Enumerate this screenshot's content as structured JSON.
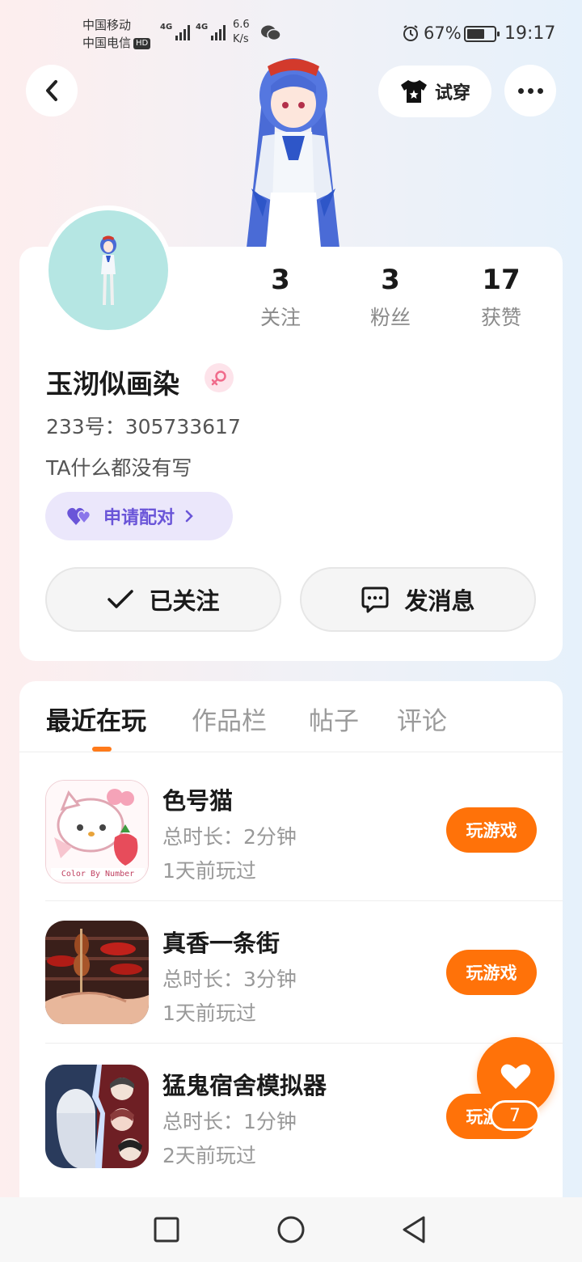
{
  "status_bar": {
    "carrier_1": "中国移动",
    "carrier_2": "中国电信",
    "hd_badge": "HD",
    "network_1": "4G",
    "network_2": "4G",
    "net_speed_value": "6.6",
    "net_speed_unit": "K/s",
    "battery_percent": "67%",
    "battery_level": 0.67,
    "time": "19:17"
  },
  "header": {
    "try_on_label": "试穿"
  },
  "profile": {
    "stats": [
      {
        "value": "3",
        "label": "关注"
      },
      {
        "value": "3",
        "label": "粉丝"
      },
      {
        "value": "17",
        "label": "获赞"
      }
    ],
    "nickname": "玉沏似画染",
    "uid": "233号：305733617",
    "bio": "TA什么都没有写",
    "pair_label": "申请配对",
    "follow_label": "已关注",
    "message_label": "发消息",
    "accent_color": "#6a55d8"
  },
  "tabs": [
    {
      "label": "最近在玩",
      "active": true
    },
    {
      "label": "作品栏",
      "active": false
    },
    {
      "label": "帖子",
      "active": false
    },
    {
      "label": "评论",
      "active": false
    }
  ],
  "games": [
    {
      "title": "色号猫",
      "duration": "总时长：2分钟",
      "last_played": "1天前玩过",
      "play_label": "玩游戏",
      "icon_text": "Color By Number"
    },
    {
      "title": "真香一条街",
      "duration": "总时长：3分钟",
      "last_played": "1天前玩过",
      "play_label": "玩游戏"
    },
    {
      "title": "猛鬼宿舍模拟器",
      "duration": "总时长：1分钟",
      "last_played": "2天前玩过",
      "play_label": "玩游戏"
    }
  ],
  "fab": {
    "count": "7",
    "color": "#ff7209"
  }
}
